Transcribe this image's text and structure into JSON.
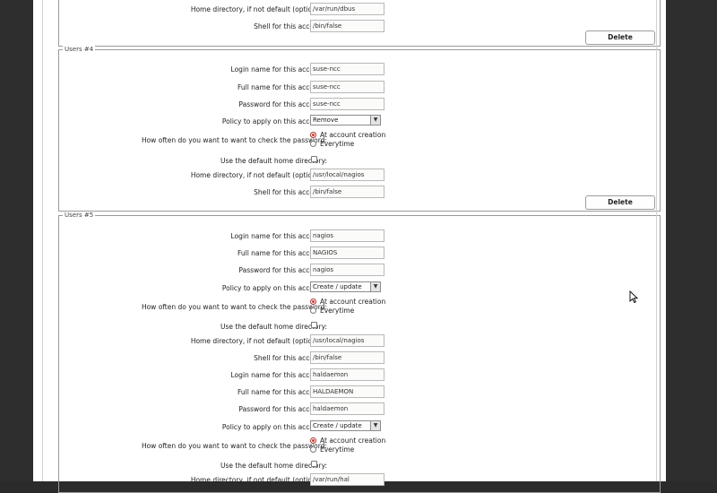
{
  "labels": {
    "login": "Login name for this account:",
    "fullname": "Full name for this account:",
    "password": "Password for this account:",
    "policy": "Policy to apply on this account:",
    "howoften": "How often do you want to want to check the password:",
    "default_home": "Use the default home directory:",
    "home_dir": "Home directory, if not default (optional):",
    "shell": "Shell for this account:",
    "at_creation": "At account creation",
    "everytime": "Everytime",
    "delete": "Delete"
  },
  "user3": {
    "home": "/var/run/dbus",
    "shell": "/bin/false"
  },
  "user4": {
    "legend": "Users #4",
    "login": "suse-ncc",
    "fullname": "suse-ncc",
    "password": "suse-ncc",
    "policy": "Remove",
    "home": "/usr/local/nagios",
    "shell": "/bin/false"
  },
  "user5": {
    "legend": "Users #5",
    "a": {
      "login": "nagios",
      "fullname": "NAGIOS",
      "password": "nagios",
      "policy": "Create / update",
      "home": "/usr/local/nagios",
      "shell": "/bin/false"
    },
    "b": {
      "login": "haldaemon",
      "fullname": "HALDAEMON",
      "password": "haldaemon",
      "policy": "Create / update",
      "home": "/var/run/hal"
    }
  }
}
